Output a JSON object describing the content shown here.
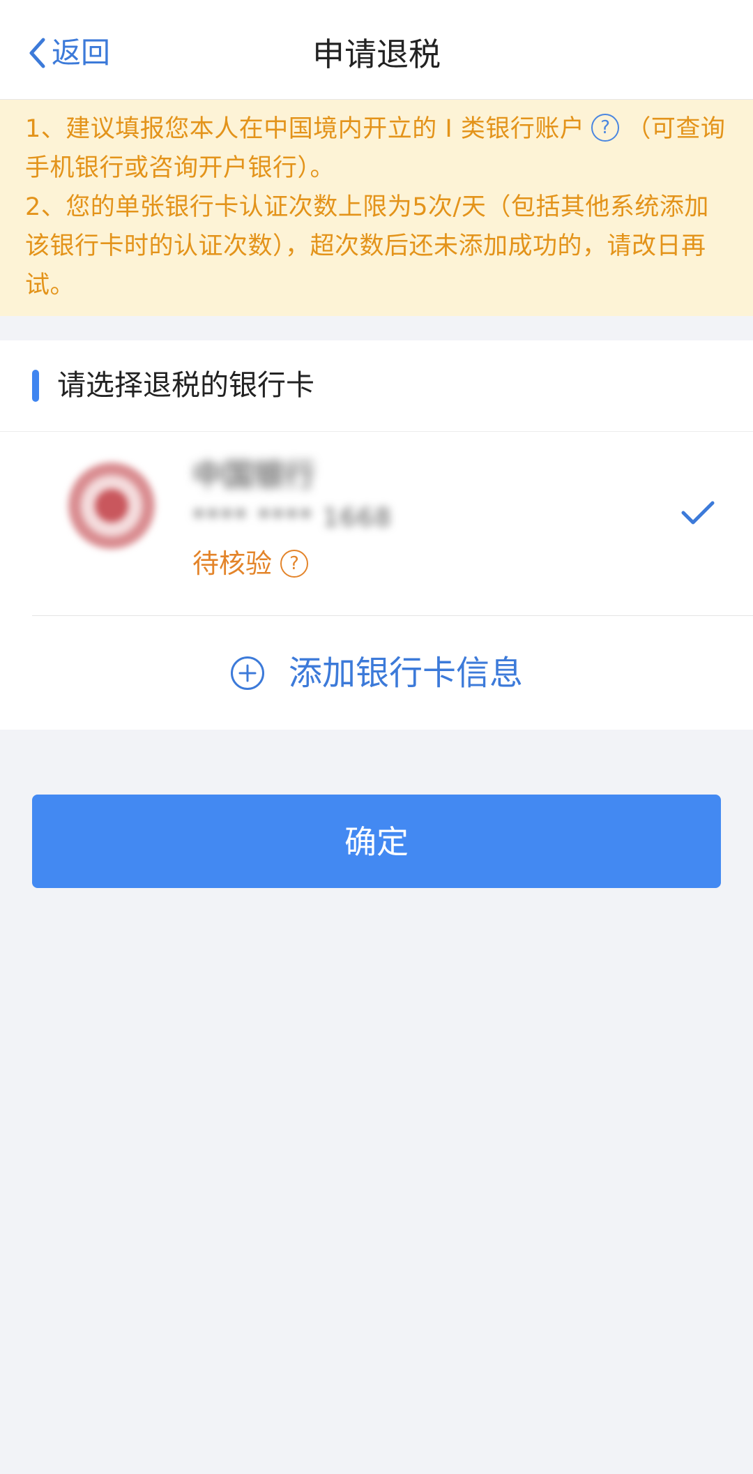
{
  "header": {
    "back_label": "返回",
    "title": "申请退税"
  },
  "notice": {
    "line1_before": "1、建议填报您本人在中国境内开立的 I 类银行账户",
    "line1_after": "（可查询手机银行或咨询开户银行）。",
    "line2": "2、您的单张银行卡认证次数上限为5次/天（包括其他系统添加该银行卡时的认证次数），超次数后还未添加成功的，请改日再试。",
    "help_glyph": "?"
  },
  "section": {
    "title": "请选择退税的银行卡"
  },
  "bank_card": {
    "name": "中国银行",
    "number": "**** **** 1668",
    "status": "待核验",
    "status_help_glyph": "?",
    "selected": true,
    "logo_icon": "bank-of-china-logo",
    "check_icon": "check-icon"
  },
  "add_card": {
    "label": "添加银行卡信息",
    "icon": "plus-circle-icon"
  },
  "confirm": {
    "label": "确定"
  },
  "colors": {
    "accent": "#4389f2",
    "link": "#3c7ad9",
    "warning_text": "#e3931a",
    "notice_bg": "#fdf3d6",
    "page_bg": "#f2f3f7"
  }
}
